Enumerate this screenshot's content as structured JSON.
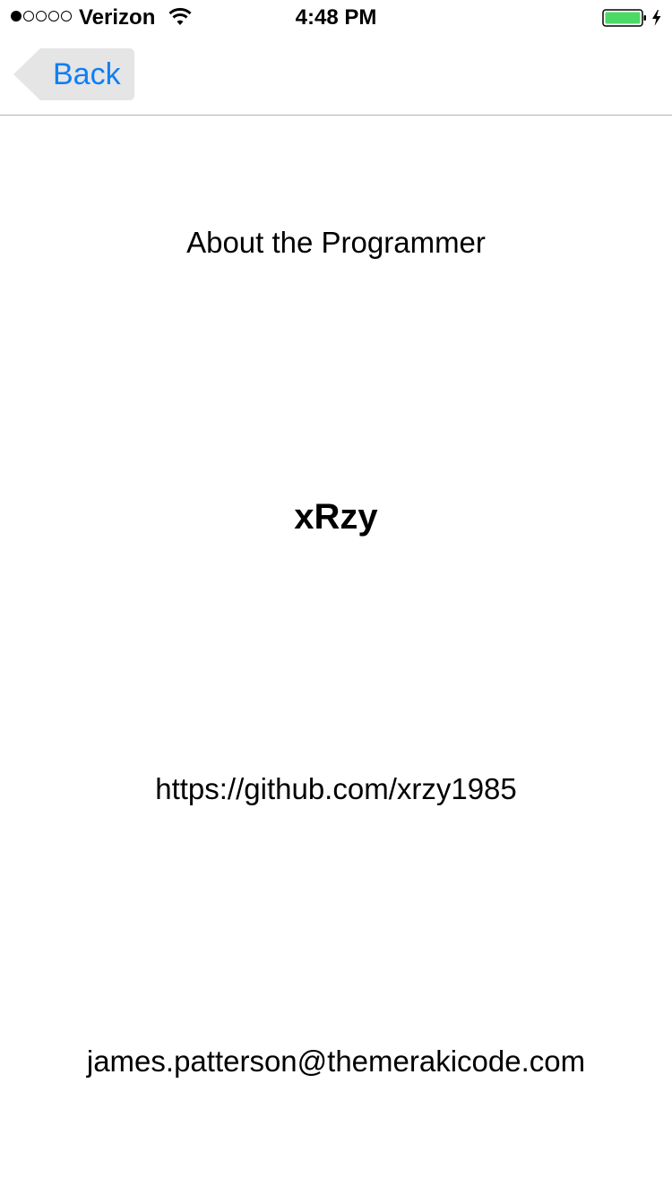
{
  "status_bar": {
    "signal_strength_filled": 1,
    "signal_strength_total": 5,
    "carrier": "Verizon",
    "time": "4:48 PM",
    "battery_level": 1.0,
    "charging": true,
    "battery_color": "#4cd964"
  },
  "nav": {
    "back_label": "Back",
    "accent_color": "#0f7ff5"
  },
  "content": {
    "title": "About the Programmer",
    "username": "xRzy",
    "github_url": "https://github.com/xrzy1985",
    "email": "james.patterson@themerakicode.com"
  }
}
